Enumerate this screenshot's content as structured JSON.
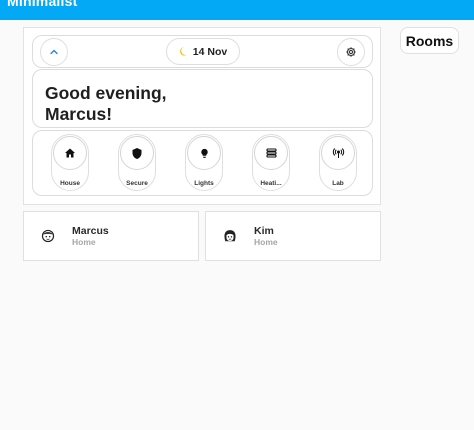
{
  "app": {
    "title": "Minimalist"
  },
  "header": {
    "date": "14 Nov",
    "date_icon": "moon-icon"
  },
  "greeting": {
    "line1": "Good evening,",
    "line2": "Marcus!"
  },
  "rooms": [
    {
      "label": "House",
      "icon": "home-icon"
    },
    {
      "label": "Secure",
      "icon": "shield-icon"
    },
    {
      "label": "Lights",
      "icon": "lightbulb-icon"
    },
    {
      "label": "Heati...",
      "icon": "radiator-icon"
    },
    {
      "label": "Lab",
      "icon": "antenna-icon"
    }
  ],
  "people": [
    {
      "name": "Marcus",
      "status": "Home",
      "icon": "face-man-icon"
    },
    {
      "name": "Kim",
      "status": "Home",
      "icon": "face-woman-icon"
    }
  ],
  "side": {
    "rooms_title": "Rooms"
  },
  "colors": {
    "app_bar": "#03a9f4",
    "chevron_accent": "#1e88e5",
    "moon": "#f5b400"
  }
}
